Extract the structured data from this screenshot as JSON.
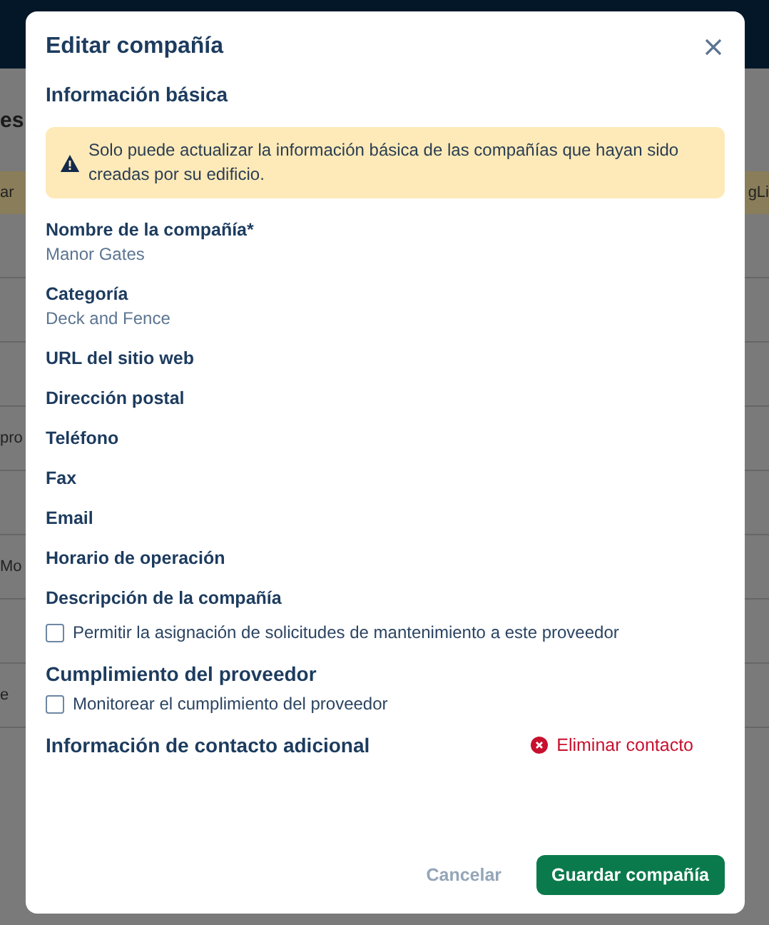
{
  "background": {
    "heading": "es",
    "banner_left": "ar",
    "banner_right": "gLi",
    "rows": [
      {
        "text": ""
      },
      {
        "text": ""
      },
      {
        "text": ""
      },
      {
        "text": "pro"
      },
      {
        "text": ""
      },
      {
        "text": "Mo"
      },
      {
        "text": ""
      },
      {
        "text": "e"
      }
    ]
  },
  "dialog": {
    "title": "Editar compañía",
    "section": "Información básica",
    "alert": "Solo puede actualizar la información básica de las compañías que hayan sido creadas por su edificio.",
    "fields": [
      {
        "label": "Nombre de la compañía*",
        "value": "Manor Gates"
      },
      {
        "label": "Categoría",
        "value": "Deck and Fence"
      },
      {
        "label": "URL del sitio web"
      },
      {
        "label": "Dirección postal"
      },
      {
        "label": "Teléfono"
      },
      {
        "label": "Fax"
      },
      {
        "label": "Email"
      },
      {
        "label": "Horario de operación"
      },
      {
        "label": "Descripción de la compañía"
      }
    ],
    "assign_checkbox": {
      "label": "Permitir la asignación de solicitudes de mantenimiento a este proveedor",
      "checked": false
    },
    "compliance": {
      "title": "Cumplimiento del proveedor",
      "checkbox": {
        "label": "Monitorear el cumplimiento del proveedor",
        "checked": false
      }
    },
    "contact": {
      "title": "Información de contacto adicional",
      "remove": "Eliminar contacto"
    },
    "buttons": {
      "cancel": "Cancelar",
      "save": "Guardar compañía"
    }
  }
}
